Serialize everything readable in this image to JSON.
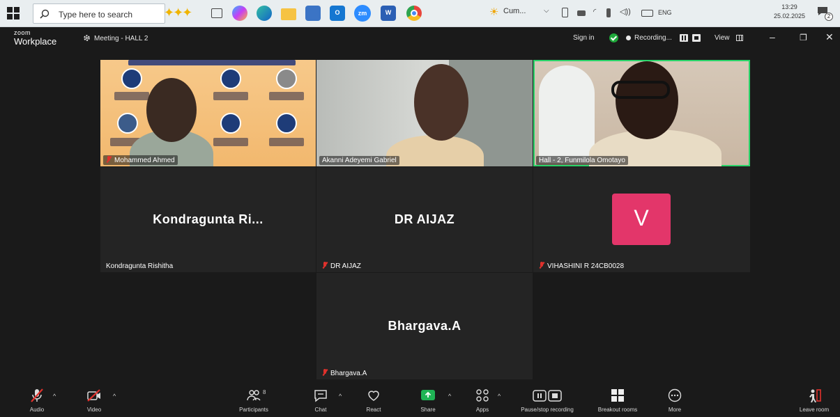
{
  "taskbar": {
    "search_placeholder": "Type here to search",
    "weather": "Cum...",
    "language": "ENG",
    "time": "13:29",
    "date": "25.02.2025",
    "notification_count": "2"
  },
  "zoom": {
    "logo_top": "zoom",
    "logo_bottom": "Workplace",
    "meeting_title": "Meeting - HALL 2",
    "sign_in": "Sign in",
    "recording": "Recording...",
    "view": "View"
  },
  "participants": [
    {
      "name": "Mohammed Ahmed",
      "muted": true,
      "type": "video"
    },
    {
      "name": "Akanni Adeyemi Gabriel",
      "muted": false,
      "type": "video"
    },
    {
      "name": "Hall - 2, Funmilola Omotayo",
      "muted": false,
      "type": "video",
      "active_speaker": true
    },
    {
      "name": "Kondragunta Rishitha",
      "display": "Kondragunta  Ri...",
      "muted": false,
      "type": "name"
    },
    {
      "name": "DR AIJAZ",
      "display": "DR AIJAZ",
      "muted": true,
      "type": "name"
    },
    {
      "name": "VIHASHINI R 24CB0028",
      "avatar_letter": "V",
      "muted": true,
      "type": "avatar"
    },
    {
      "name": "Bhargava.A",
      "display": "Bhargava.A",
      "muted": true,
      "type": "name"
    }
  ],
  "toolbar": {
    "audio": "Audio",
    "video": "Video",
    "participants": "Participants",
    "participant_count": "8",
    "chat": "Chat",
    "react": "React",
    "share": "Share",
    "apps": "Apps",
    "pause_stop": "Pause/stop recording",
    "breakout": "Breakout rooms",
    "more": "More",
    "leave": "Leave room"
  },
  "colors": {
    "accent_green": "#2bd56a",
    "share_green": "#1fb355",
    "muted_red": "#e0312c",
    "avatar_pink": "#e3366a"
  }
}
